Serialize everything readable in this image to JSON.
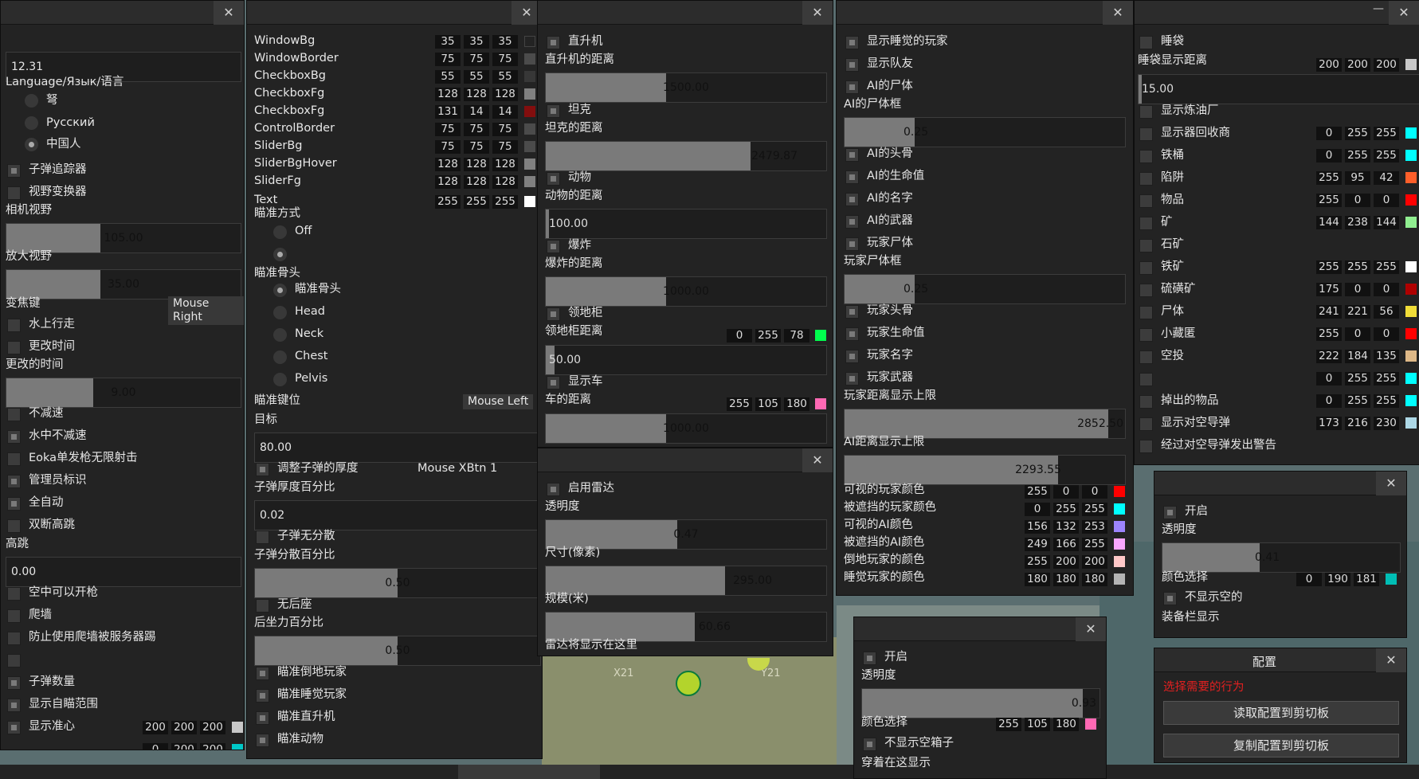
{
  "background": {
    "grid": [
      "X21",
      "Y21"
    ]
  },
  "p1": {
    "version": "12.31",
    "language_label": "Language/Язык/语言",
    "languages": [
      "弩",
      "Русский",
      "中国人"
    ],
    "bullet_tracker": "子弹追踪器",
    "fov_changer": "视野变换器",
    "camera_fov": "相机视野",
    "camera_fov_value": "105.00",
    "zoom_fov": "放大视野",
    "zoom_fov_value": "35.00",
    "zoom_key": "变焦键",
    "zoom_key_value": "Mouse Right",
    "water_walk": "水上行走",
    "change_time": "更改时间",
    "changed_time": "更改的时间",
    "changed_time_value": "9.00",
    "no_slowdown": "不减速",
    "water_no_slow": "水中不减速",
    "eoka": "Eoka单发枪无限射击",
    "admin_flag": "管理员标识",
    "full_auto": "全自动",
    "double_jump": "双断高跳",
    "high_jump": "高跳",
    "high_jump_value": "0.00",
    "air_shoot": "空中可以开枪",
    "climb": "爬墙",
    "anti_climb_kick": "防止使用爬墙被服务器踢",
    "bullet_count": "子弹数量",
    "show_aim_range": "显示自瞄范围",
    "show_crosshair": "显示准心",
    "aim_range_color": [
      "200",
      "200",
      "200"
    ],
    "crosshair_color": [
      "0",
      "200",
      "200"
    ]
  },
  "p2": {
    "colors": [
      {
        "name": "WindowBg",
        "rgb": [
          "35",
          "35",
          "35"
        ]
      },
      {
        "name": "WindowBorder",
        "rgb": [
          "75",
          "75",
          "75"
        ]
      },
      {
        "name": "CheckboxBg",
        "rgb": [
          "55",
          "55",
          "55"
        ]
      },
      {
        "name": "CheckboxFg",
        "rgb": [
          "128",
          "128",
          "128"
        ]
      },
      {
        "name": "CheckboxFg",
        "rgb": [
          "131",
          "14",
          "14"
        ]
      },
      {
        "name": "ControlBorder",
        "rgb": [
          "75",
          "75",
          "75"
        ]
      },
      {
        "name": "SliderBg",
        "rgb": [
          "75",
          "75",
          "75"
        ]
      },
      {
        "name": "SliderBgHover",
        "rgb": [
          "128",
          "128",
          "128"
        ]
      },
      {
        "name": "SliderFg",
        "rgb": [
          "128",
          "128",
          "128"
        ]
      },
      {
        "name": "Text",
        "rgb": [
          "255",
          "255",
          "255"
        ]
      }
    ],
    "aim_mode": "瞄准方式",
    "aim_off": "Off",
    "aim_bone": "瞄准骨头",
    "bones": [
      "瞄准骨头",
      "Head",
      "Neck",
      "Chest",
      "Pelvis"
    ],
    "aim_key": "瞄准键位",
    "aim_key_value": "Mouse Left",
    "target": "目标",
    "target_value": "80.00",
    "bullet_thick": "调整子弹的厚度",
    "bullet_thick_key": "Mouse XBtn 1",
    "thick_pct": "子弹厚度百分比",
    "thick_pct_value": "0.02",
    "no_spread": "子弹无分散",
    "spread_pct": "子弹分散百分比",
    "spread_pct_value": "0.50",
    "no_recoil": "无后座",
    "recoil_pct": "后坐力百分比",
    "recoil_pct_value": "0.50",
    "aim_downed": "瞄准倒地玩家",
    "aim_sleeping": "瞄准睡觉玩家",
    "aim_heli": "瞄准直升机",
    "aim_animal": "瞄准动物"
  },
  "p3": {
    "heli": "直升机",
    "heli_dist": "直升机的距离",
    "heli_dist_value": "1500.00",
    "tank": "坦克",
    "tank_dist": "坦克的距离",
    "tank_dist_value": "2479.87",
    "animal": "动物",
    "animal_dist": "动物的距离",
    "animal_dist_value": "100.00",
    "explosion": "爆炸",
    "explosion_dist": "爆炸的距离",
    "explosion_dist_value": "1000.00",
    "cupboard": "领地柜",
    "cupboard_dist": "领地柜距离",
    "cupboard_color": [
      "0",
      "255",
      "78"
    ],
    "cupboard_dist_value": "50.00",
    "vehicle": "显示车",
    "vehicle_dist": "车的距离",
    "vehicle_color": [
      "255",
      "105",
      "180"
    ],
    "vehicle_dist_value": "1000.00"
  },
  "p4": {
    "enable": "启用雷达",
    "opacity": "透明度",
    "opacity_value": "0.47",
    "size": "尺寸(像素)",
    "size_value": "295.00",
    "scale": "规模(米)",
    "scale_value": "60.66",
    "hint": "雷达将显示在这里"
  },
  "p5": {
    "sleepers": "显示睡觉的玩家",
    "team": "显示队友",
    "ai_corpse": "AI的尸体",
    "ai_corpse_box": "AI的尸体框",
    "ai_corpse_value": "0.25",
    "ai_head": "AI的头骨",
    "ai_health": "AI的生命值",
    "ai_name": "AI的名字",
    "ai_weapon": "AI的武器",
    "player_corpse": "玩家尸体",
    "player_corpse_box": "玩家尸体框",
    "player_corpse_value": "0.25",
    "player_head": "玩家头骨",
    "player_health": "玩家生命值",
    "player_name": "玩家名字",
    "player_weapon": "玩家武器",
    "player_dist_max": "玩家距离显示上限",
    "player_dist_value": "2852.50",
    "ai_dist_max": "AI距离显示上限",
    "ai_dist_value": "2293.55",
    "colors": [
      {
        "name": "可视的玩家颜色",
        "rgb": [
          "255",
          "0",
          "0"
        ],
        "hex": "#ff0000"
      },
      {
        "name": "被遮挡的玩家颜色",
        "rgb": [
          "0",
          "255",
          "255"
        ],
        "hex": "#00ffff"
      },
      {
        "name": "可视的AI颜色",
        "rgb": [
          "156",
          "132",
          "253"
        ],
        "hex": "#9c84fd"
      },
      {
        "name": "被遮挡的AI颜色",
        "rgb": [
          "249",
          "166",
          "255"
        ],
        "hex": "#f9a6ff"
      },
      {
        "name": "倒地玩家的颜色",
        "rgb": [
          "255",
          "200",
          "200"
        ],
        "hex": "#ffc8c8"
      },
      {
        "name": "睡觉玩家的颜色",
        "rgb": [
          "180",
          "180",
          "180"
        ],
        "hex": "#b4b4b4"
      }
    ]
  },
  "p6": {
    "enable": "开启",
    "opacity": "透明度",
    "opacity_value": "0.93",
    "color_pick": "颜色选择",
    "color": [
      "255",
      "105",
      "180"
    ],
    "hide_empty": "不显示空箱子",
    "wear_hint": "穿着在这显示"
  },
  "p7": {
    "sleeping_bag": "睡袋",
    "bag_dist": "睡袋显示距离",
    "bag_color": [
      "200",
      "200",
      "200"
    ],
    "bag_dist_value": "15.00",
    "refinery": "显示炼油厂",
    "items": [
      {
        "name": "显示器回收商",
        "rgb": [
          "0",
          "255",
          "255"
        ],
        "hex": "#00ffff"
      },
      {
        "name": "铁桶",
        "rgb": [
          "0",
          "255",
          "255"
        ],
        "hex": "#00ffff"
      },
      {
        "name": "陷阱",
        "rgb": [
          "255",
          "95",
          "42"
        ],
        "hex": "#ff5f2a"
      },
      {
        "name": "物品",
        "rgb": [
          "255",
          "0",
          "0"
        ],
        "hex": "#ff0000"
      },
      {
        "name": "矿",
        "rgb": [
          "144",
          "238",
          "144"
        ],
        "hex": "#90ee90"
      },
      {
        "name": "石矿",
        "rgb": null,
        "hex": null
      },
      {
        "name": "铁矿",
        "rgb": [
          "255",
          "255",
          "255"
        ],
        "hex": "#ffffff"
      },
      {
        "name": "硫磺矿",
        "rgb": [
          "175",
          "0",
          "0"
        ],
        "hex": "#af0000"
      },
      {
        "name": "尸体",
        "rgb": [
          "241",
          "221",
          "56"
        ],
        "hex": "#f1dd38"
      },
      {
        "name": "小藏匿",
        "rgb": [
          "255",
          "0",
          "0"
        ],
        "hex": "#ff0000"
      },
      {
        "name": "空投",
        "rgb": [
          "222",
          "184",
          "135"
        ],
        "hex": "#deb887"
      },
      {
        "name": "",
        "rgb": [
          "0",
          "255",
          "255"
        ],
        "hex": "#00ffff"
      },
      {
        "name": "掉出的物品",
        "rgb": [
          "0",
          "255",
          "255"
        ],
        "hex": "#00ffff"
      },
      {
        "name": "显示对空导弹",
        "rgb": [
          "173",
          "216",
          "230"
        ],
        "hex": "#add8e6"
      }
    ],
    "sam_warning": "经过对空导弹发出警告"
  },
  "p8": {
    "enable": "开启",
    "opacity": "透明度",
    "opacity_value": "0.41",
    "color_pick": "颜色选择",
    "color": [
      "0",
      "190",
      "181"
    ],
    "hide_empty": "不显示空的",
    "hint": "装备栏显示"
  },
  "p9": {
    "title": "配置",
    "subtitle": "选择需要的行为",
    "load": "读取配置到剪切板",
    "copy": "复制配置到剪切板"
  },
  "win": {
    "close": "✕",
    "minimize": "—"
  }
}
